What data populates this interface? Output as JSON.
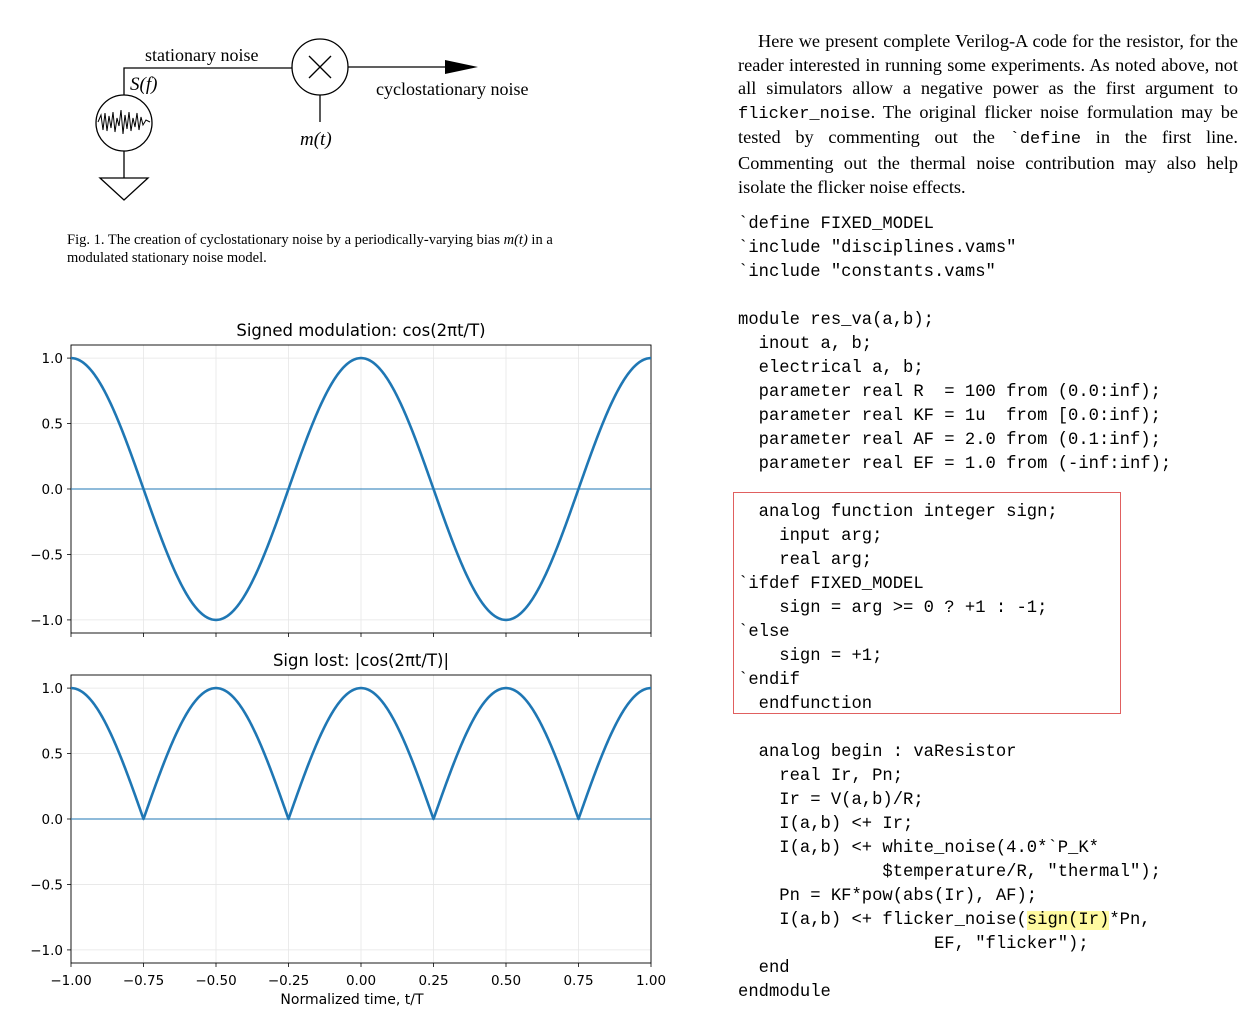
{
  "figure": {
    "labels": {
      "stationary": "stationary noise",
      "sf": "S(f)",
      "cyclo": "cyclostationary noise",
      "mt": "m(t)"
    },
    "caption": {
      "prefix": "Fig. 1.  The creation of cyclostationary noise by a periodically-varying bias",
      "math": "m(t)",
      "suffix": " in a modulated stationary noise model."
    }
  },
  "chart_data": [
    {
      "type": "line",
      "title": "Signed modulation: cos(2πt/T)",
      "function": "cos(2*pi*t)",
      "xlim": [
        -1.0,
        1.0
      ],
      "ylim": [
        -1.1,
        1.1
      ],
      "yticks": [
        "1.0",
        "0.5",
        "0.0",
        "−0.5",
        "−1.0"
      ],
      "grid": true,
      "color": "#1f77b4",
      "baseline_y": 0
    },
    {
      "type": "line",
      "title": "Sign lost: |cos(2πt/T)|",
      "function": "abs(cos(2*pi*t))",
      "xlim": [
        -1.0,
        1.0
      ],
      "ylim": [
        -1.1,
        1.1
      ],
      "yticks": [
        "1.0",
        "0.5",
        "0.0",
        "−0.5",
        "−1.0"
      ],
      "xticks": [
        "−1.00",
        "−0.75",
        "−0.50",
        "−0.25",
        "0.00",
        "0.25",
        "0.50",
        "0.75",
        "1.00"
      ],
      "xlabel": "Normalized time, t/T",
      "grid": true,
      "color": "#1f77b4",
      "baseline_y": 0
    }
  ],
  "text": {
    "para_a": "Here we present complete Verilog-A code for the resistor, for the reader interested in running some experiments. As noted above, not all simulators allow a negative power as the first argument to ",
    "para_code1": "flicker_noise",
    "para_b": ". The original flicker noise formulation may be tested by commenting out the ",
    "para_code2": "`define",
    "para_c": " in the first line. Commenting out the thermal noise contribution may also help isolate the flicker noise effects."
  },
  "code": {
    "l1": "`define FIXED_MODEL",
    "l2": "`include \"disciplines.vams\"",
    "l3": "`include \"constants.vams\"",
    "l4": "module res_va(a,b);",
    "l5": "  inout a, b;",
    "l6": "  electrical a, b;",
    "l7": "  parameter real R  = 100 from (0.0:inf);",
    "l8": "  parameter real KF = 1u  from [0.0:inf);",
    "l9": "  parameter real AF = 2.0 from (0.1:inf);",
    "l10": "  parameter real EF = 1.0 from (-inf:inf);",
    "l11": "  analog function integer sign;",
    "l12": "    input arg;",
    "l13": "    real arg;",
    "l14": "`ifdef FIXED_MODEL",
    "l15": "    sign = arg >= 0 ? +1 : -1;",
    "l16": "`else",
    "l17": "    sign = +1;",
    "l18": "`endif",
    "l19": "  endfunction",
    "l20": "  analog begin : vaResistor",
    "l21": "    real Ir, Pn;",
    "l22": "    Ir = V(a,b)/R;",
    "l23": "    I(a,b) <+ Ir;",
    "l24": "    I(a,b) <+ white_noise(4.0*`P_K*",
    "l25": "              $temperature/R, \"thermal\");",
    "l26": "    Pn = KF*pow(abs(Ir), AF);",
    "l27a": "    I(a,b) <+ flicker_noise(",
    "l27b": "sign(Ir)",
    "l27c": "*Pn,",
    "l28": "                   EF, \"flicker\");",
    "l29": "  end",
    "l30": "endmodule"
  },
  "colors": {
    "curve": "#1f77b4",
    "highlight": "#fffaa0",
    "box": "#e06060"
  }
}
